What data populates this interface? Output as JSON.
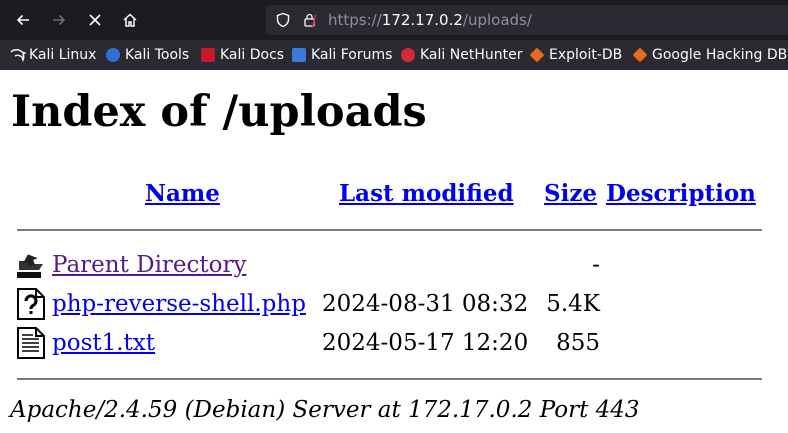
{
  "browser": {
    "url_scheme": "https://",
    "url_host": "172.17.0.2",
    "url_path": "/uploads/",
    "bookmarks": [
      {
        "label": "Kali Linux",
        "icon": "kali-dragon-icon"
      },
      {
        "label": "Kali Tools",
        "icon": "kali-tools-icon"
      },
      {
        "label": "Kali Docs",
        "icon": "kali-docs-icon"
      },
      {
        "label": "Kali Forums",
        "icon": "kali-forums-icon"
      },
      {
        "label": "Kali NetHunter",
        "icon": "kali-nethunter-icon"
      },
      {
        "label": "Exploit-DB",
        "icon": "exploit-db-icon"
      },
      {
        "label": "Google Hacking DB",
        "icon": "ghdb-icon"
      }
    ]
  },
  "page": {
    "title": "Index of /uploads",
    "columns": {
      "name": "Name",
      "last_modified": "Last modified",
      "size": "Size",
      "description": "Description"
    },
    "rows": [
      {
        "name": "Parent Directory",
        "modified": "",
        "size": "-",
        "icon": "back-folder-icon"
      },
      {
        "name": "php-reverse-shell.php",
        "modified": "2024-08-31 08:32",
        "size": "5.4K",
        "icon": "unknown-file-icon"
      },
      {
        "name": "post1.txt",
        "modified": "2024-05-17 12:20",
        "size": "855",
        "icon": "text-file-icon"
      }
    ],
    "footer": "Apache/2.4.59 (Debian) Server at 172.17.0.2 Port 443"
  }
}
